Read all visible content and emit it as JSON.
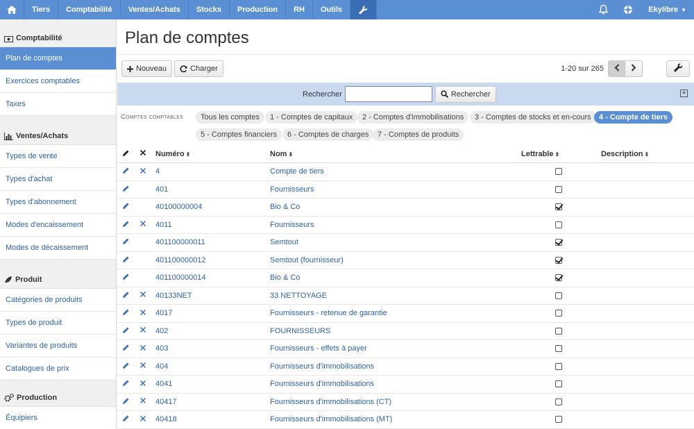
{
  "nav": {
    "items": [
      "Tiers",
      "Comptabilité",
      "Ventes/Achats",
      "Stocks",
      "Production",
      "RH",
      "Outils"
    ],
    "user": "Ekylibre"
  },
  "sidebar": {
    "sections": [
      {
        "title": "Comptabilité",
        "icon": "money-icon",
        "items": [
          "Plan de comptes",
          "Exercices comptables",
          "Taxes"
        ]
      },
      {
        "title": "Ventes/Achats",
        "icon": "bar-chart-icon",
        "items": [
          "Types de vente",
          "Types d'achat",
          "Types d'abonnement",
          "Modes d'encaissement",
          "Modes de décaissement"
        ]
      },
      {
        "title": "Produit",
        "icon": "leaf-icon",
        "items": [
          "Catégories de produits",
          "Types de produit",
          "Variantes de produits",
          "Catalogues de prix"
        ]
      },
      {
        "title": "Production",
        "icon": "cogs-icon",
        "items": [
          "Équipiers"
        ]
      }
    ]
  },
  "page": {
    "title": "Plan de comptes",
    "new_label": "Nouveau",
    "load_label": "Charger",
    "pagination": "1-20 sur 265"
  },
  "search": {
    "label": "Rechercher",
    "value": "",
    "button": "Rechercher"
  },
  "filters": {
    "label": "Comptes comptables",
    "chips": [
      "Tous les comptes",
      "1 - Comptes de capitaux",
      "2 - Comptes d'immobilisations",
      "3 - Comptes de stocks et en-cours",
      "4 - Compte de tiers",
      "5 - Comptes financiers",
      "6 - Comptes de charges",
      "7 - Comptes de produits"
    ],
    "active": "4 - Compte de tiers"
  },
  "table": {
    "headers": {
      "numero": "Numéro",
      "nom": "Nom",
      "lettrable": "Lettrable",
      "description": "Description"
    },
    "rows": [
      {
        "numero": "4",
        "nom": "Compte de tiers",
        "lettrable": false,
        "deletable": true
      },
      {
        "numero": "401",
        "nom": "Fournisseurs",
        "lettrable": false,
        "deletable": false
      },
      {
        "numero": "40100000004",
        "nom": "Bio & Co",
        "lettrable": true,
        "deletable": false
      },
      {
        "numero": "4011",
        "nom": "Fournisseurs",
        "lettrable": false,
        "deletable": true
      },
      {
        "numero": "401100000011",
        "nom": "Semtout",
        "lettrable": true,
        "deletable": false
      },
      {
        "numero": "401100000012",
        "nom": "Semtout (fournisseur)",
        "lettrable": true,
        "deletable": false
      },
      {
        "numero": "401100000014",
        "nom": "Bio & Co",
        "lettrable": true,
        "deletable": false
      },
      {
        "numero": "40133NET",
        "nom": "33 NETTOYAGE",
        "lettrable": false,
        "deletable": true
      },
      {
        "numero": "4017",
        "nom": "Fournisseurs - retenue de garantie",
        "lettrable": false,
        "deletable": true
      },
      {
        "numero": "402",
        "nom": "FOURNISSEURS",
        "lettrable": false,
        "deletable": true
      },
      {
        "numero": "403",
        "nom": "Fournisseurs - effets à payer",
        "lettrable": false,
        "deletable": true
      },
      {
        "numero": "404",
        "nom": "Fournisseurs d'immobilisations",
        "lettrable": false,
        "deletable": true
      },
      {
        "numero": "4041",
        "nom": "Fournisseurs d'immobilisations",
        "lettrable": false,
        "deletable": true
      },
      {
        "numero": "40417",
        "nom": "Fournisseurs d'immobilisations (CT)",
        "lettrable": false,
        "deletable": true
      },
      {
        "numero": "40418",
        "nom": "Fournisseurs d'immobilisations (MT)",
        "lettrable": false,
        "deletable": true
      }
    ]
  },
  "colors": {
    "nav": "#5a8fd4",
    "active_nav": "#3a6db3",
    "link": "#2f62a8",
    "searchbar": "#c9d9ef"
  }
}
